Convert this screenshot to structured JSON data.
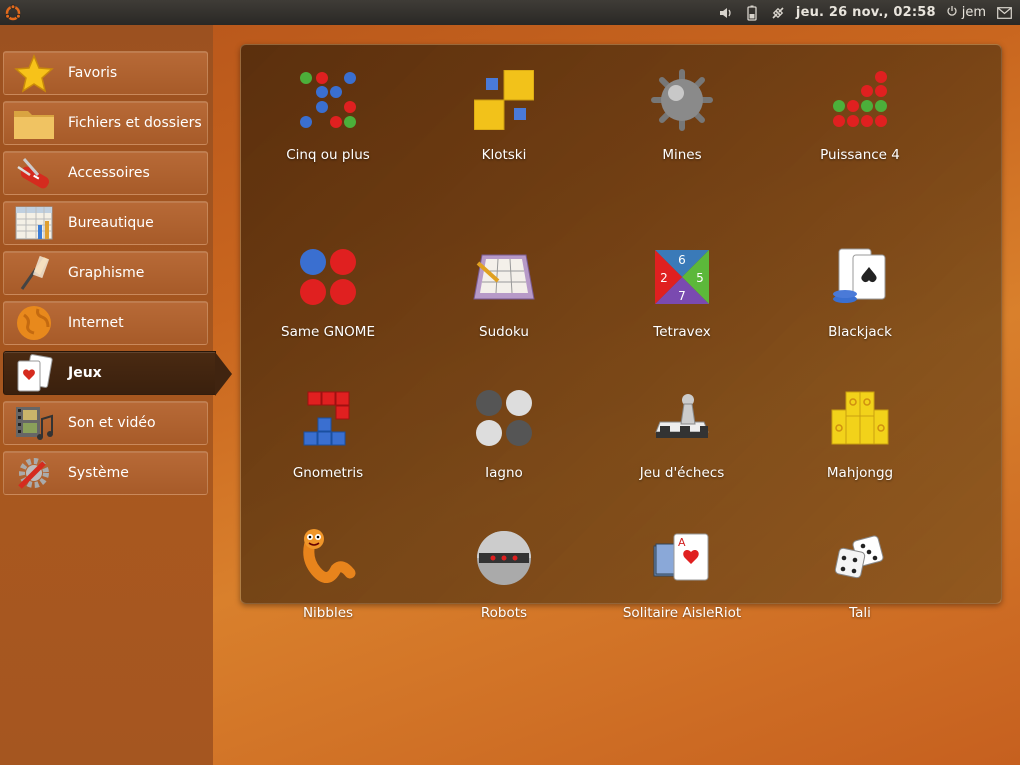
{
  "panel": {
    "clock": "jeu. 26 nov., 02:58",
    "user": "jem"
  },
  "sidebar": {
    "items": [
      {
        "label": "Favoris",
        "icon": "star-icon"
      },
      {
        "label": "Fichiers et dossiers",
        "icon": "folder-icon"
      },
      {
        "label": "Accessoires",
        "icon": "swiss-knife-icon"
      },
      {
        "label": "Bureautique",
        "icon": "spreadsheet-icon"
      },
      {
        "label": "Graphisme",
        "icon": "paint-brush-icon"
      },
      {
        "label": "Internet",
        "icon": "globe-icon"
      },
      {
        "label": "Jeux",
        "icon": "playing-cards-icon",
        "active": true
      },
      {
        "label": "Son et vidéo",
        "icon": "film-music-icon"
      },
      {
        "label": "Système",
        "icon": "gear-wrench-icon"
      }
    ]
  },
  "apps": [
    {
      "label": "Cinq ou plus",
      "icon": "five-or-more-icon"
    },
    {
      "label": "Klotski",
      "icon": "klotski-icon"
    },
    {
      "label": "Mines",
      "icon": "mine-icon"
    },
    {
      "label": "Puissance 4",
      "icon": "four-in-a-row-icon"
    },
    {
      "label": "Same GNOME",
      "icon": "same-gnome-icon"
    },
    {
      "label": "Sudoku",
      "icon": "sudoku-icon"
    },
    {
      "label": "Tetravex",
      "icon": "tetravex-icon"
    },
    {
      "label": "Blackjack",
      "icon": "blackjack-icon"
    },
    {
      "label": "Gnometris",
      "icon": "gnometris-icon"
    },
    {
      "label": "Iagno",
      "icon": "iagno-icon"
    },
    {
      "label": "Jeu d'échecs",
      "icon": "chess-icon"
    },
    {
      "label": "Mahjongg",
      "icon": "mahjongg-icon"
    },
    {
      "label": "Nibbles",
      "icon": "nibbles-worm-icon"
    },
    {
      "label": "Robots",
      "icon": "robot-icon"
    },
    {
      "label": "Solitaire AisleRiot",
      "icon": "solitaire-cards-icon"
    },
    {
      "label": "Tali",
      "icon": "dice-icon"
    }
  ],
  "colors": {
    "accent": "#c9661f",
    "panel_dark": "#2a2825",
    "active_item": "#402410"
  }
}
